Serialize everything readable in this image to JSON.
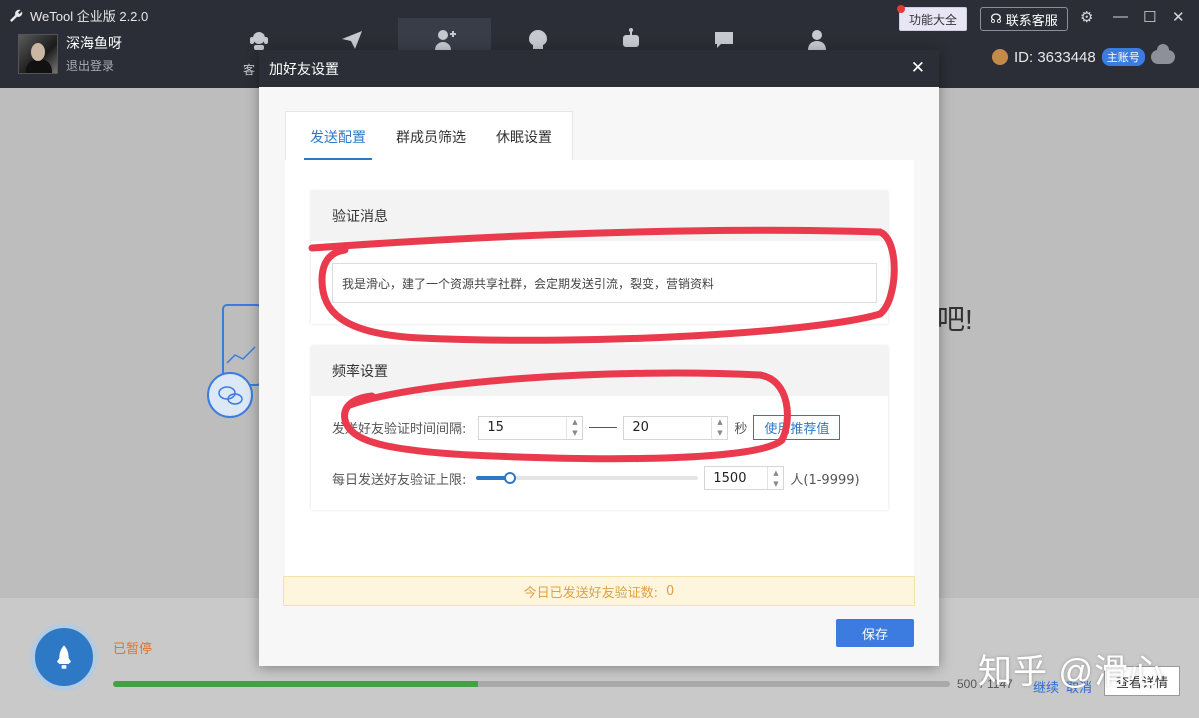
{
  "app": {
    "title": "WeTool 企业版 2.2.0"
  },
  "user": {
    "name": "深海鱼呀",
    "logout": "退出登录"
  },
  "nav": {
    "partial_label": "客"
  },
  "header": {
    "features": "功能大全",
    "service": "联系客服",
    "id_text": "ID: 3633448",
    "account_badge": "主账号"
  },
  "background": {
    "welcome_fragment": "吧!"
  },
  "status": {
    "paused": "已暂停",
    "count": "500 / 1147",
    "progress": 0.436,
    "continue": "继续",
    "cancel": "取消",
    "detail": "查看详情"
  },
  "watermark": "知乎 @滑心",
  "dialog": {
    "title": "加好友设置",
    "tabs": [
      {
        "label": "发送配置"
      },
      {
        "label": "群成员筛选"
      },
      {
        "label": "休眠设置"
      }
    ],
    "verify": {
      "heading": "验证消息",
      "message": "我是滑心，建了一个资源共享社群，会定期发送引流，裂变，营销资料"
    },
    "frequency": {
      "heading": "频率设置",
      "interval_label": "发送好友验证时间间隔:",
      "min_interval": "15",
      "max_interval": "20",
      "unit": "秒",
      "recommend": "使用推荐值",
      "daily_label": "每日发送好友验证上限:",
      "daily_limit": "1500",
      "daily_fraction": 0.15,
      "range": "人(1-9999)"
    },
    "today_label": "今日已发送好友验证数:",
    "today_count": "0",
    "save": "保存"
  },
  "colors": {
    "accent": "#2e79c6",
    "titlebar": "#2b2e36",
    "annotation": "#ea3b4e",
    "progress": "#43a047"
  }
}
